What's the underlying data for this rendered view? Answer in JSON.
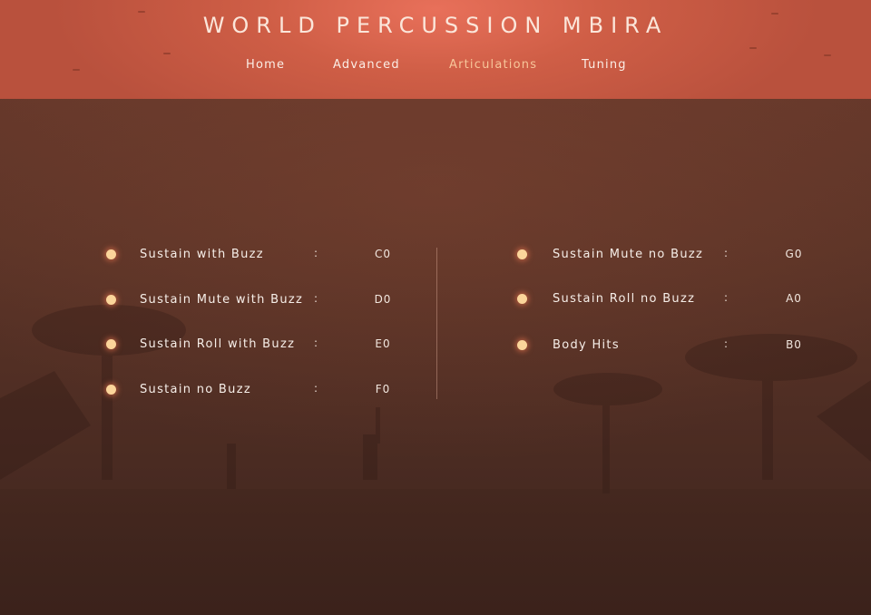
{
  "header": {
    "title": "WORLD PERCUSSION MBIRA",
    "nav": [
      {
        "label": "Home",
        "active": false
      },
      {
        "label": "Advanced",
        "active": false
      },
      {
        "label": "Articulations",
        "active": true
      },
      {
        "label": "Tuning",
        "active": false
      }
    ]
  },
  "articulations": {
    "left": [
      {
        "name": "Sustain with Buzz",
        "sep": ":",
        "key": "C0"
      },
      {
        "name": "Sustain Mute with Buzz",
        "sep": ":",
        "key": "D0"
      },
      {
        "name": "Sustain Roll with Buzz",
        "sep": ":",
        "key": "E0"
      },
      {
        "name": "Sustain no Buzz",
        "sep": ":",
        "key": "F0"
      }
    ],
    "right": [
      {
        "name": "Sustain Mute no Buzz",
        "sep": ":",
        "key": "G0"
      },
      {
        "name": "Sustain Roll no Buzz",
        "sep": ":",
        "key": "A0"
      },
      {
        "name": "Body Hits",
        "sep": ":",
        "key": "B0"
      }
    ]
  },
  "colors": {
    "header_accent": "#e8705a",
    "active_nav": "#f7c69a",
    "indicator": "#fbd59a",
    "background": "#5c3427"
  }
}
